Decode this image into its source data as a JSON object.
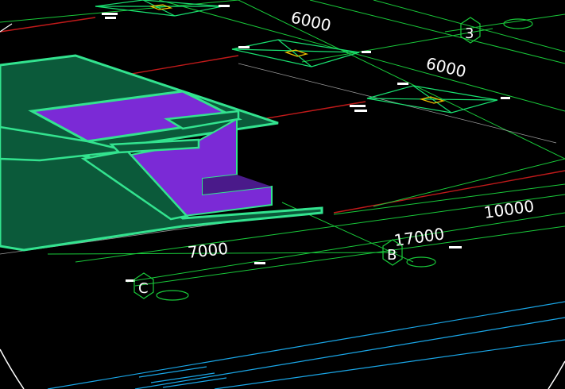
{
  "app": {
    "view": "3D perspective CAD drawing — building plan with structural grid"
  },
  "dimensions": {
    "span_top_a": "6000",
    "span_top_b": "6000",
    "span_right": "10000",
    "span_total": "17000",
    "span_left": "7000"
  },
  "axes": {
    "axis_3": "3",
    "axis_b": "B",
    "axis_c": "C"
  },
  "colors": {
    "background": "#000000",
    "grid_green": "#19c93a",
    "axis_red": "#c11a1a",
    "slab_edge": "#33e38f",
    "slab_fill": "#0b5a3a",
    "column_purple": "#7b2ad6",
    "cyan_line": "#1aa7e8",
    "dim_text": "#ffffff"
  }
}
